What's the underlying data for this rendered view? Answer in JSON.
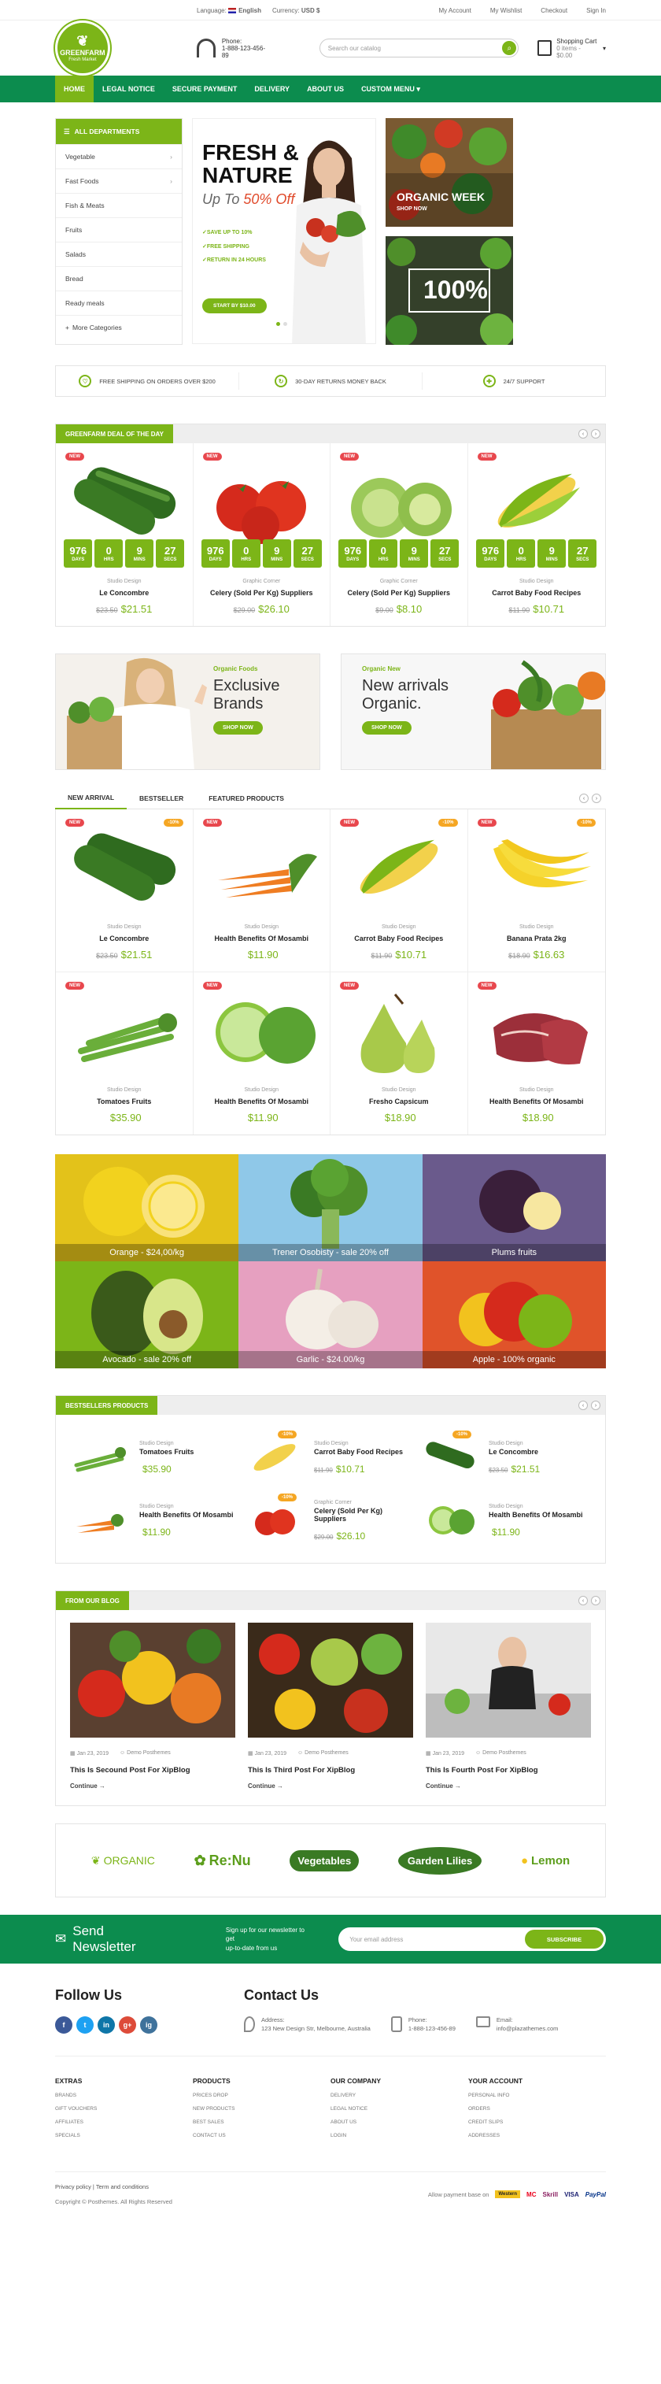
{
  "topbar": {
    "language_label": "Language:",
    "language": "English",
    "currency_label": "Currency:",
    "currency": "USD $",
    "links": [
      "My Account",
      "My Wishlist",
      "Checkout",
      "Sign In"
    ]
  },
  "logo": {
    "line1": "GREENFARM",
    "line2": "Fresh Market"
  },
  "phone": {
    "label": "Phone:",
    "number": "1-888-123-456-89"
  },
  "search": {
    "placeholder": "Search our catalog"
  },
  "cart": {
    "label": "Shopping Cart",
    "summary": "0 items - $0.00"
  },
  "nav": [
    "HOME",
    "LEGAL NOTICE",
    "SECURE PAYMENT",
    "DELIVERY",
    "ABOUT US",
    "CUSTOM MENU ▾"
  ],
  "departments": {
    "title": "ALL DEPARTMENTS",
    "items": [
      "Vegetable",
      "Fast Foods",
      "Fish & Meats",
      "Fruits",
      "Salads",
      "Bread",
      "Ready meals",
      "More Categories"
    ]
  },
  "hero": {
    "title1": "FRESH &",
    "title2": "NATURE",
    "sub": "Up To ",
    "sub_pct": "50% Off",
    "bullets": [
      "SAVE UP TO 10%",
      "FREE SHIPPING",
      "RETURN IN 24 HOURS"
    ],
    "cta": "START BY $10.00"
  },
  "promos": [
    {
      "title": "ORGANIC WEEK",
      "link": "SHOP NOW"
    },
    {
      "title": "100%"
    }
  ],
  "features": [
    "FREE SHIPPING ON ORDERS OVER $200",
    "30-DAY RETURNS MONEY BACK",
    "24/7 SUPPORT"
  ],
  "deal": {
    "title": "GREENFARM DEAL OF THE DAY",
    "timer": {
      "days": "976",
      "hrs": "0",
      "mins": "9",
      "secs": "27",
      "labels": [
        "DAYS",
        "HRS",
        "MINS",
        "SECS"
      ]
    },
    "products": [
      {
        "badge": "NEW",
        "brand": "Studio Design",
        "name": "Le Concombre",
        "old": "$23.50",
        "price": "$21.51"
      },
      {
        "badge": "NEW",
        "brand": "Graphic Corner",
        "name": "Celery (Sold Per Kg) Suppliers",
        "old": "$29.00",
        "price": "$26.10"
      },
      {
        "badge": "NEW",
        "brand": "Graphic Corner",
        "name": "Celery (Sold Per Kg) Suppliers",
        "old": "$9.00",
        "price": "$8.10"
      },
      {
        "badge": "NEW",
        "brand": "Studio Design",
        "name": "Carrot Baby Food Recipes",
        "old": "$11.90",
        "price": "$10.71"
      }
    ]
  },
  "banners": [
    {
      "small": "Organic Foods",
      "line1": "Exclusive",
      "line2": "Brands",
      "cta": "SHOP NOW"
    },
    {
      "small": "Organic New",
      "line1": "New arrivals",
      "line2": "Organic.",
      "cta": "SHOP NOW"
    }
  ],
  "tabs": [
    "NEW ARRIVAL",
    "BESTSELLER",
    "FEATURED PRODUCTS"
  ],
  "arrivals": [
    {
      "badge": "NEW",
      "sale": "-10%",
      "brand": "Studio Design",
      "name": "Le Concombre",
      "old": "$23.50",
      "price": "$21.51"
    },
    {
      "badge": "NEW",
      "sale": "",
      "brand": "Studio Design",
      "name": "Health Benefits Of Mosambi",
      "old": "",
      "price": "$11.90"
    },
    {
      "badge": "NEW",
      "sale": "-10%",
      "brand": "Studio Design",
      "name": "Carrot Baby Food Recipes",
      "old": "$11.90",
      "price": "$10.71"
    },
    {
      "badge": "NEW",
      "sale": "-10%",
      "brand": "Studio Design",
      "name": "Banana Prata 2kg",
      "old": "$18.90",
      "price": "$16.63"
    },
    {
      "badge": "NEW",
      "sale": "",
      "brand": "Studio Design",
      "name": "Tomatoes Fruits",
      "old": "",
      "price": "$35.90"
    },
    {
      "badge": "NEW",
      "sale": "",
      "brand": "Studio Design",
      "name": "Health Benefits Of Mosambi",
      "old": "",
      "price": "$11.90"
    },
    {
      "badge": "NEW",
      "sale": "",
      "brand": "Studio Design",
      "name": "Fresho Capsicum",
      "old": "",
      "price": "$18.90"
    },
    {
      "badge": "NEW",
      "sale": "",
      "brand": "Studio Design",
      "name": "Health Benefits Of Mosambi",
      "old": "",
      "price": "$18.90"
    }
  ],
  "mosaic": [
    "Orange - $24,00/kg",
    "Trener Osobisty - sale 20% off",
    "Plums fruits",
    "Avocado - sale 20% off",
    "Garlic - $24.00/kg",
    "Apple - 100% organic"
  ],
  "bestsellers": {
    "title": "BESTSELLERS PRODUCTS",
    "items": [
      {
        "brand": "Studio Design",
        "name": "Tomatoes Fruits",
        "old": "",
        "price": "$35.90",
        "sale": ""
      },
      {
        "brand": "Studio Design",
        "name": "Carrot Baby Food Recipes",
        "old": "$11.90",
        "price": "$10.71",
        "sale": "-10%"
      },
      {
        "brand": "Studio Design",
        "name": "Le Concombre",
        "old": "$23.50",
        "price": "$21.51",
        "sale": "-10%"
      },
      {
        "brand": "Studio Design",
        "name": "Health Benefits Of Mosambi",
        "old": "",
        "price": "$11.90",
        "sale": ""
      },
      {
        "brand": "Graphic Corner",
        "name": "Celery (Sold Per Kg) Suppliers",
        "old": "$29.00",
        "price": "$26.10",
        "sale": "-10%"
      },
      {
        "brand": "Studio Design",
        "name": "Health Benefits Of Mosambi",
        "old": "",
        "price": "$11.90",
        "sale": ""
      }
    ]
  },
  "blog": {
    "title": "FROM OUR BLOG",
    "posts": [
      {
        "date": "Jan 23, 2019",
        "author": "Demo Posthemes",
        "title": "This Is Secound Post For XipBlog",
        "more": "Continue"
      },
      {
        "date": "Jan 23, 2019",
        "author": "Demo Posthemes",
        "title": "This Is Third Post For XipBlog",
        "more": "Continue"
      },
      {
        "date": "Jan 23, 2019",
        "author": "Demo Posthemes",
        "title": "This Is Fourth Post For XipBlog",
        "more": "Continue"
      }
    ]
  },
  "brands": [
    "ORGANIC",
    "Re:Nu",
    "Vegetables",
    "Garden Lilies",
    "Lemon"
  ],
  "newsletter": {
    "title": "Send Newsletter",
    "desc1": "Sign up for our newsletter to get",
    "desc2": "up-to-date from us",
    "placeholder": "Your email address",
    "button": "SUBSCRIBE"
  },
  "follow": {
    "title": "Follow Us",
    "icons": [
      "f",
      "t",
      "in",
      "g+",
      "ig"
    ]
  },
  "contact": {
    "title": "Contact Us",
    "address_label": "Address:",
    "address": "123 New Design Str, Melbourne, Australia",
    "phone_label": "Phone:",
    "phone": "1-888-123-456-89",
    "email_label": "Email:",
    "email": "info@plazathemes.com"
  },
  "footer_cols": [
    {
      "title": "EXTRAS",
      "items": [
        "BRANDS",
        "GIFT VOUCHERS",
        "AFFILIATES",
        "SPECIALS"
      ]
    },
    {
      "title": "PRODUCTS",
      "items": [
        "PRICES DROP",
        "NEW PRODUCTS",
        "BEST SALES",
        "CONTACT US"
      ]
    },
    {
      "title": "OUR COMPANY",
      "items": [
        "DELIVERY",
        "LEGAL NOTICE",
        "ABOUT US",
        "LOGIN"
      ]
    },
    {
      "title": "YOUR ACCOUNT",
      "items": [
        "PERSONAL INFO",
        "ORDERS",
        "CREDIT SLIPS",
        "ADDRESSES"
      ]
    }
  ],
  "bottom": {
    "links": "Privacy policy | Term and conditions",
    "copyright": "Copyright © Posthemes. All Rights Reserved",
    "pay_label": "Allow payment base on",
    "pay": [
      "Western",
      "MC",
      "Skrill",
      "VISA",
      "PayPal"
    ]
  },
  "colors": {
    "green": "#7cb518",
    "dark_green": "#0c8c4e",
    "red": "#e8474d",
    "orange": "#f5a623"
  }
}
